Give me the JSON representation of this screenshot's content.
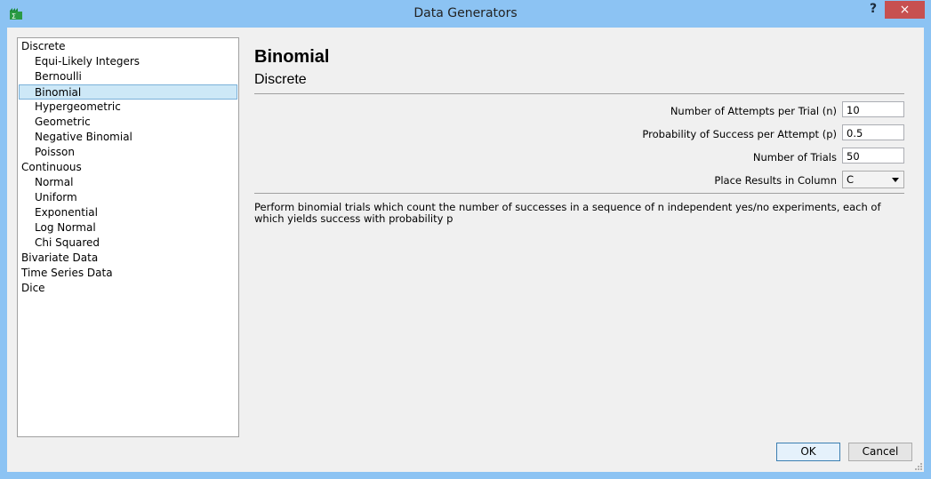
{
  "window": {
    "title": "Data Generators",
    "help_label": "?",
    "close_label": "×"
  },
  "tree": {
    "items": [
      {
        "label": "Discrete",
        "level": 0
      },
      {
        "label": "Equi-Likely Integers",
        "level": 1
      },
      {
        "label": "Bernoulli",
        "level": 1
      },
      {
        "label": "Binomial",
        "level": 1,
        "selected": true
      },
      {
        "label": "Hypergeometric",
        "level": 1
      },
      {
        "label": "Geometric",
        "level": 1
      },
      {
        "label": "Negative Binomial",
        "level": 1
      },
      {
        "label": "Poisson",
        "level": 1
      },
      {
        "label": "Continuous",
        "level": 0
      },
      {
        "label": "Normal",
        "level": 1
      },
      {
        "label": "Uniform",
        "level": 1
      },
      {
        "label": "Exponential",
        "level": 1
      },
      {
        "label": "Log Normal",
        "level": 1
      },
      {
        "label": "Chi Squared",
        "level": 1
      },
      {
        "label": "Bivariate Data",
        "level": 0
      },
      {
        "label": "Time Series Data",
        "level": 0
      },
      {
        "label": "Dice",
        "level": 0
      }
    ]
  },
  "panel": {
    "title": "Binomial",
    "subtitle": "Discrete",
    "fields": [
      {
        "label": "Number of Attempts per Trial (n)",
        "value": "10"
      },
      {
        "label": "Probability of Success per Attempt (p)",
        "value": "0.5"
      },
      {
        "label": "Number of Trials",
        "value": "50"
      }
    ],
    "column_label": "Place Results in Column",
    "column_value": "C",
    "description": "Perform binomial trials which count the number of successes in a sequence of n independent yes/no experiments, each of which yields success with probability p"
  },
  "buttons": {
    "ok": "OK",
    "cancel": "Cancel"
  }
}
